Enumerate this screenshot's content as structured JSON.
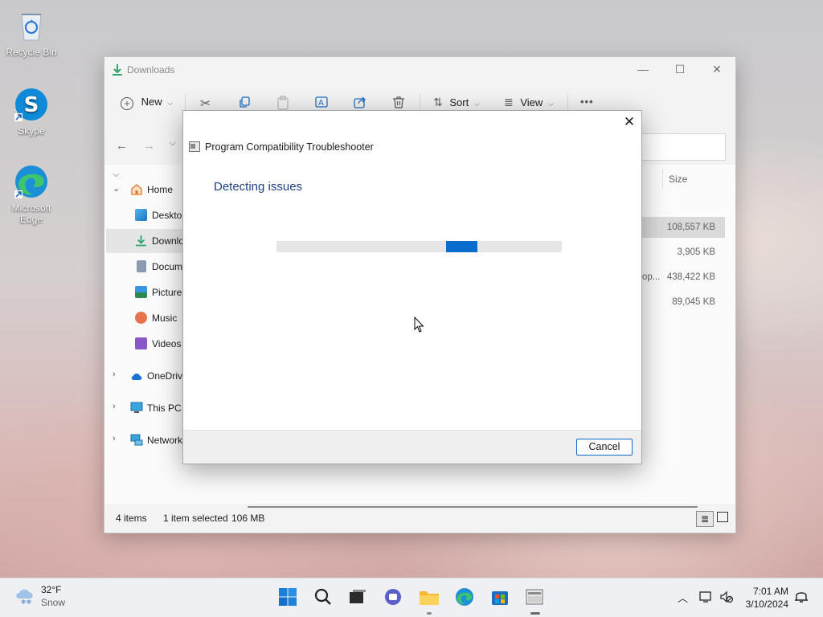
{
  "desktop": {
    "icons": [
      {
        "label": "Recycle Bin"
      },
      {
        "label": "Skype"
      },
      {
        "label": "Microsoft Edge"
      }
    ]
  },
  "explorer": {
    "title": "Downloads",
    "toolbar": {
      "new_label": "New",
      "sort_label": "Sort",
      "view_label": "View",
      "more_label": "•••"
    },
    "sidebar": {
      "home": "Home",
      "items": [
        "Desktop",
        "Downloads",
        "Documents",
        "Pictures",
        "Music",
        "Videos"
      ],
      "onedrive": "OneDrive",
      "thispc": "This PC",
      "network": "Network"
    },
    "columns": {
      "size": "Size"
    },
    "rows": [
      {
        "name_tail": "",
        "size": "108,557 KB"
      },
      {
        "name_tail": "",
        "size": "3,905 KB"
      },
      {
        "name_tail": "op...",
        "size": "438,422 KB"
      },
      {
        "name_tail": "",
        "size": "89,045 KB"
      }
    ],
    "status": {
      "count": "4 items",
      "selection": "1 item selected",
      "selection_size": "106 MB"
    }
  },
  "dialog": {
    "title": "Program Compatibility Troubleshooter",
    "heading": "Detecting issues",
    "close_label": "✕",
    "cancel_label": "Cancel",
    "progress": {
      "indeterminate": true,
      "segment_color": "#0a6ccd"
    }
  },
  "taskbar": {
    "weather": {
      "temp": "32°F",
      "condition": "Snow"
    },
    "clock": {
      "time": "7:01 AM",
      "date": "3/10/2024"
    }
  }
}
